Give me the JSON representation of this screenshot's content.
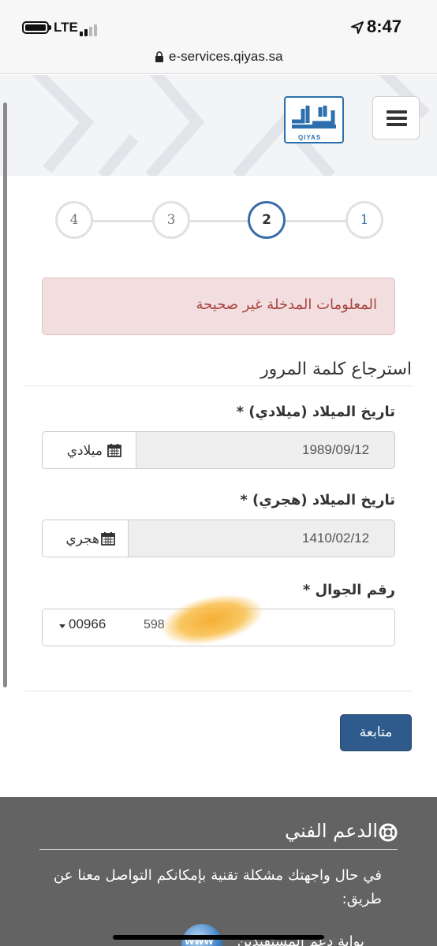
{
  "status_bar": {
    "network": "LTE",
    "time": "8:47"
  },
  "browser": {
    "url": "e-services.qiyas.sa"
  },
  "header": {
    "logo_text": "QIYAS"
  },
  "stepper": {
    "steps": [
      "1",
      "2",
      "3",
      "4"
    ],
    "current_step": 2
  },
  "alert": {
    "message": "المعلومات المدخلة غير صحيحة"
  },
  "form": {
    "title": "استرجاع كلمة المرور",
    "gregorian_label": "تاريخ الميلاد (ميلادي) *",
    "gregorian_value": "1989/09/12",
    "gregorian_addon": "ميلادي",
    "hijri_label": "تاريخ الميلاد (هجري) *",
    "hijri_value": "1410/02/12",
    "hijri_addon": "هجري",
    "mobile_label": "رقم الجوال *",
    "country_code": "00966",
    "mobile_value": "598",
    "submit_label": "متابعة"
  },
  "footer": {
    "support_title": "الدعم الفني",
    "support_text": "في حال واجهتك مشكلة تقنية بإمكانكم التواصل معنا عن طريق:",
    "portal_label": "بوابة دعم المستفيدين",
    "www_label": "WWW"
  },
  "colors": {
    "primary": "#2e5b8c",
    "step_active": "#3a6ea8",
    "alert_bg": "#f2dede",
    "alert_text": "#a94442",
    "footer_bg": "#636363"
  }
}
